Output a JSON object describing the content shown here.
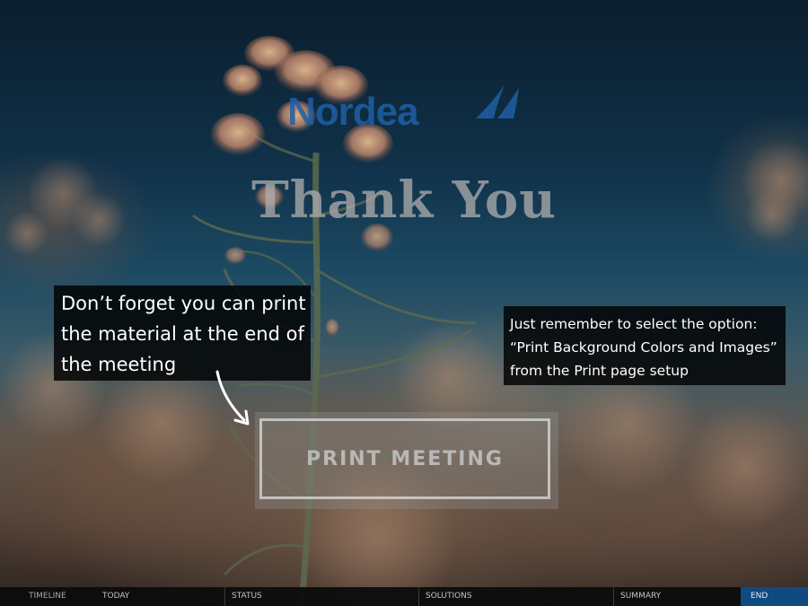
{
  "brand": {
    "logo_text": "Nordea",
    "logo_color": "#1f5fa5",
    "logo_icon": "sail-icon"
  },
  "heading": "Thank You",
  "print_note": {
    "lines": [
      "Don’t forget you can print",
      "the material at the end of",
      "the meeting"
    ]
  },
  "print_tip": {
    "lines": [
      "Just remember to select the option:",
      "“Print Background Colors and Images”",
      "from the Print page setup"
    ]
  },
  "print_button_label": "PRINT MEETING",
  "arrow_icon": "curved-arrow-icon",
  "nav": {
    "label": "TIMELINE",
    "items": [
      "TODAY",
      "STATUS",
      "SOLUTIONS",
      "SUMMARY",
      "END"
    ],
    "active": "END",
    "active_color": "#0f4a80"
  }
}
